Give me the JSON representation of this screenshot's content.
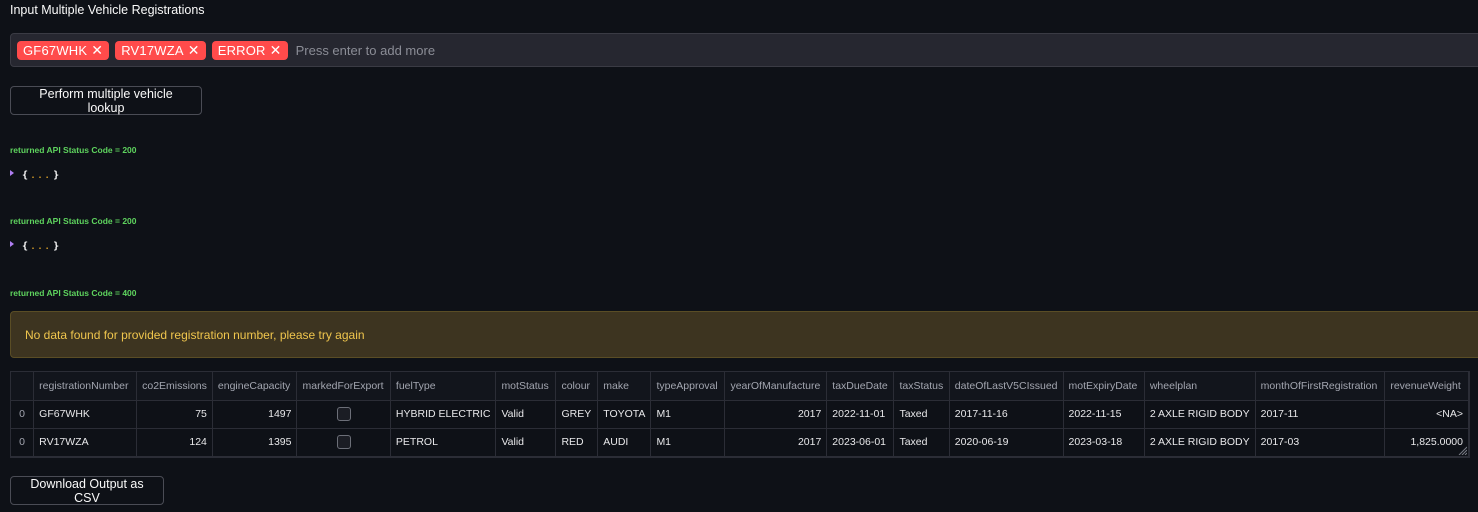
{
  "input": {
    "label": "Input Multiple Vehicle Registrations",
    "tags": [
      "GF67WHK",
      "RV17WZA",
      "ERROR"
    ],
    "remove_glyph": "✕",
    "placeholder": "Press enter to add more"
  },
  "lookup_button": "Perform multiple vehicle lookup",
  "results": [
    {
      "status": "returned API Status Code = 200",
      "json_open": "{",
      "json_dots": "...",
      "json_close": "}"
    },
    {
      "status": "returned API Status Code = 200",
      "json_open": "{",
      "json_dots": "...",
      "json_close": "}"
    },
    {
      "status": "returned API Status Code = 400"
    }
  ],
  "warning": "No data found for provided registration number, please try again",
  "table": {
    "columns": [
      "",
      "registrationNumber",
      "co2Emissions",
      "engineCapacity",
      "markedForExport",
      "fuelType",
      "motStatus",
      "colour",
      "make",
      "typeApproval",
      "yearOfManufacture",
      "taxDueDate",
      "taxStatus",
      "dateOfLastV5CIssued",
      "motExpiryDate",
      "wheelplan",
      "monthOfFirstRegistration",
      "revenueWeight"
    ],
    "rows": [
      [
        "0",
        "GF67WHK",
        "75",
        "1497",
        "",
        "HYBRID ELECTRIC",
        "Valid",
        "GREY",
        "TOYOTA",
        "M1",
        "2017",
        "2022-11-01",
        "Taxed",
        "2017-11-16",
        "2022-11-15",
        "2 AXLE RIGID BODY",
        "2017-11",
        "<NA>"
      ],
      [
        "0",
        "RV17WZA",
        "124",
        "1395",
        "",
        "PETROL",
        "Valid",
        "RED",
        "AUDI",
        "M1",
        "2017",
        "2023-06-01",
        "Taxed",
        "2020-06-19",
        "2023-03-18",
        "2 AXLE RIGID BODY",
        "2017-03",
        "1,825.0000"
      ]
    ]
  },
  "download_button": "Download Output as CSV",
  "colors": {
    "background": "#0e1117",
    "tag": "#ff4b4b",
    "status_text": "#5ed35e",
    "warning_bg": "#3d3420",
    "warning_text": "#f0c64d"
  }
}
